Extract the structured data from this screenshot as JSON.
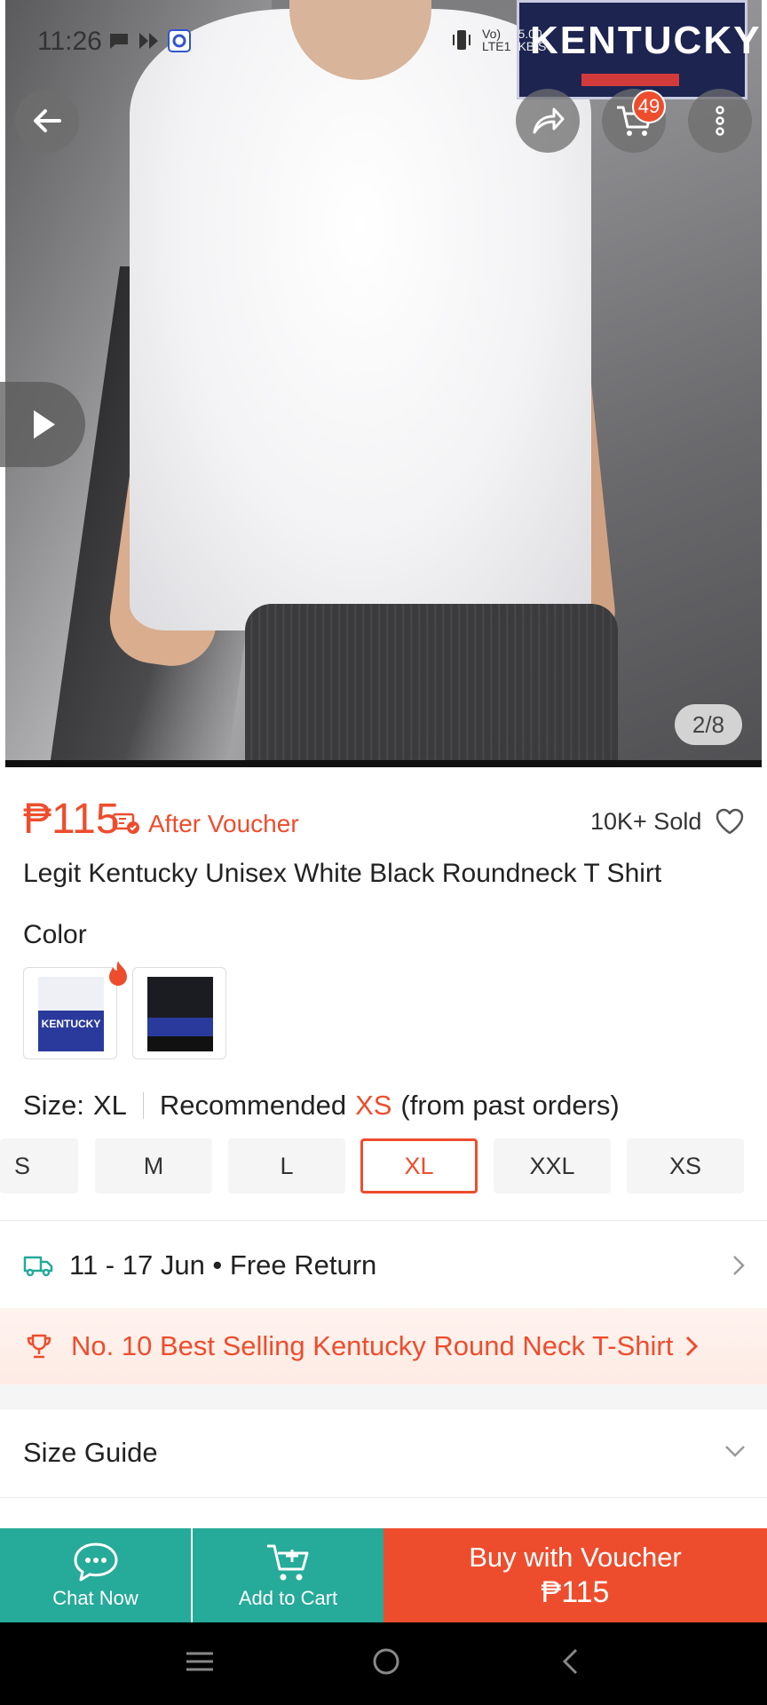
{
  "status_bar": {
    "time": "11:26",
    "network_top": "Vo)",
    "network_bottom": "LTE1",
    "speed_top": "5.00",
    "speed_bottom": "KB/S"
  },
  "gallery": {
    "counter": "2/8",
    "brand_text": "KENTUCKY",
    "cart_count": "49"
  },
  "product": {
    "currency": "₱",
    "price": "115",
    "after_voucher": "After Voucher",
    "sold": "10K+ Sold",
    "title": "Legit Kentucky Unisex White Black Roundneck T Shirt"
  },
  "variations": {
    "color_label": "Color",
    "swatch_brand": "KENTUCKY",
    "size_prefix": "Size:",
    "size_selected": "XL",
    "recommended_label": "Recommended",
    "recommended_size": "XS",
    "recommended_suffix": "(from past orders)",
    "sizes": [
      "S",
      "M",
      "L",
      "XL",
      "XXL",
      "XS"
    ]
  },
  "delivery": {
    "text": "11 - 17 Jun • Free Return"
  },
  "best_selling": {
    "text": "No. 10 Best Selling Kentucky Round Neck T-Shirt"
  },
  "size_guide": {
    "label": "Size Guide"
  },
  "actions": {
    "chat_label": "Chat Now",
    "cart_label": "Add to Cart",
    "buy_label": "Buy with Voucher",
    "buy_price": "₱115"
  },
  "colors": {
    "accent": "#ee4d2d",
    "teal": "#26aa99"
  }
}
